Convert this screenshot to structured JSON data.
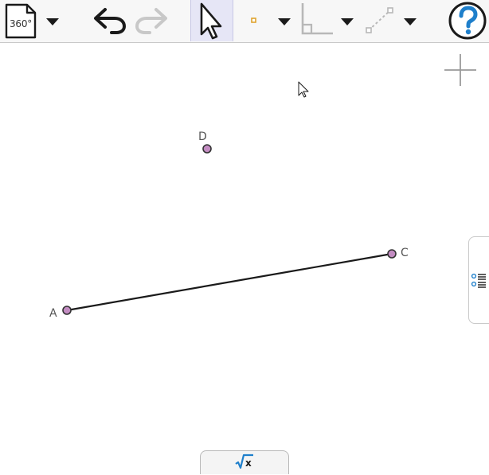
{
  "toolbar": {
    "view_icon_label": "360°",
    "buttons": [
      {
        "name": "view-menu-button",
        "icon": "document-360-icon"
      },
      {
        "name": "undo-button",
        "icon": "undo-icon"
      },
      {
        "name": "redo-button",
        "icon": "redo-icon",
        "disabled": true
      },
      {
        "name": "move-tool-button",
        "icon": "cursor-arrow-icon",
        "active": true
      },
      {
        "name": "point-tool-button",
        "icon": "point-icon"
      },
      {
        "name": "angle-tool-button",
        "icon": "angle-icon"
      },
      {
        "name": "line-tool-button",
        "icon": "dashed-line-icon"
      },
      {
        "name": "help-button",
        "icon": "help-icon"
      }
    ]
  },
  "canvas": {
    "points": [
      {
        "label": "A"
      },
      {
        "label": "C"
      },
      {
        "label": "D"
      }
    ],
    "segments": [
      {
        "from": "A",
        "to": "C"
      }
    ]
  },
  "colors": {
    "point_fill": "#c38cc2",
    "point_stroke": "#333333",
    "segment": "#1a1a1a",
    "accent": "#1e7fcb",
    "active_tool_bg": "#e6e6f6",
    "point_tool_orange": "#e0a32e"
  },
  "side_panel": {
    "icon": "algebra-list-icon"
  },
  "bottom_panel": {
    "icon": "square-root-x-icon",
    "label": "√x"
  }
}
